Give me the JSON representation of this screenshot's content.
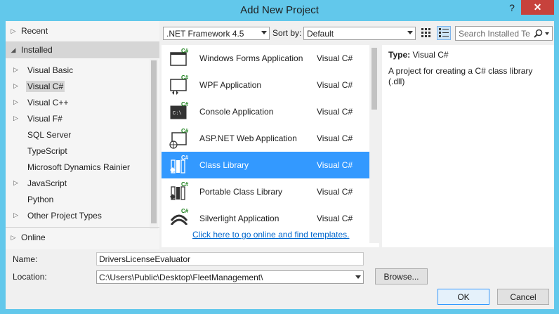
{
  "window": {
    "title": "Add New Project",
    "help_label": "?",
    "close_label": "✕"
  },
  "left_panel": {
    "recent_label": "Recent",
    "installed_label": "Installed",
    "online_label": "Online",
    "tree": [
      {
        "label": "Visual Basic",
        "expandable": true
      },
      {
        "label": "Visual C#",
        "expandable": true,
        "selected": true
      },
      {
        "label": "Visual C++",
        "expandable": true
      },
      {
        "label": "Visual F#",
        "expandable": true
      },
      {
        "label": "SQL Server",
        "expandable": false
      },
      {
        "label": "TypeScript",
        "expandable": false
      },
      {
        "label": "Microsoft Dynamics Rainier",
        "expandable": false
      },
      {
        "label": "JavaScript",
        "expandable": true
      },
      {
        "label": "Python",
        "expandable": false
      },
      {
        "label": "Other Project Types",
        "expandable": true
      }
    ]
  },
  "toolbar": {
    "framework_value": ".NET Framework 4.5",
    "sort_label": "Sort by:",
    "sort_value": "Default",
    "search_placeholder": "Search Installed Te"
  },
  "templates": [
    {
      "name": "Windows Forms Application",
      "lang": "Visual C#",
      "icon": "windows-forms-icon"
    },
    {
      "name": "WPF Application",
      "lang": "Visual C#",
      "icon": "wpf-icon"
    },
    {
      "name": "Console Application",
      "lang": "Visual C#",
      "icon": "console-icon"
    },
    {
      "name": "ASP.NET Web Application",
      "lang": "Visual C#",
      "icon": "web-app-icon"
    },
    {
      "name": "Class Library",
      "lang": "Visual C#",
      "icon": "class-library-icon",
      "selected": true
    },
    {
      "name": "Portable Class Library",
      "lang": "Visual C#",
      "icon": "portable-library-icon"
    },
    {
      "name": "Silverlight Application",
      "lang": "Visual C#",
      "icon": "silverlight-icon"
    }
  ],
  "online_link": "Click here to go online and find templates.",
  "detail": {
    "type_label": "Type:",
    "type_value": "Visual C#",
    "description": "A project for creating a C# class library (.dll)"
  },
  "form": {
    "name_label": "Name:",
    "name_value": "DriversLicenseEvaluator",
    "location_label": "Location:",
    "location_value": "C:\\Users\\Public\\Desktop\\FleetManagement\\",
    "browse_label": "Browse...",
    "ok_label": "OK",
    "cancel_label": "Cancel"
  },
  "colors": {
    "accent": "#3399ff",
    "titlebar": "#62c8eb",
    "close": "#c7423c",
    "link": "#0066cc"
  }
}
